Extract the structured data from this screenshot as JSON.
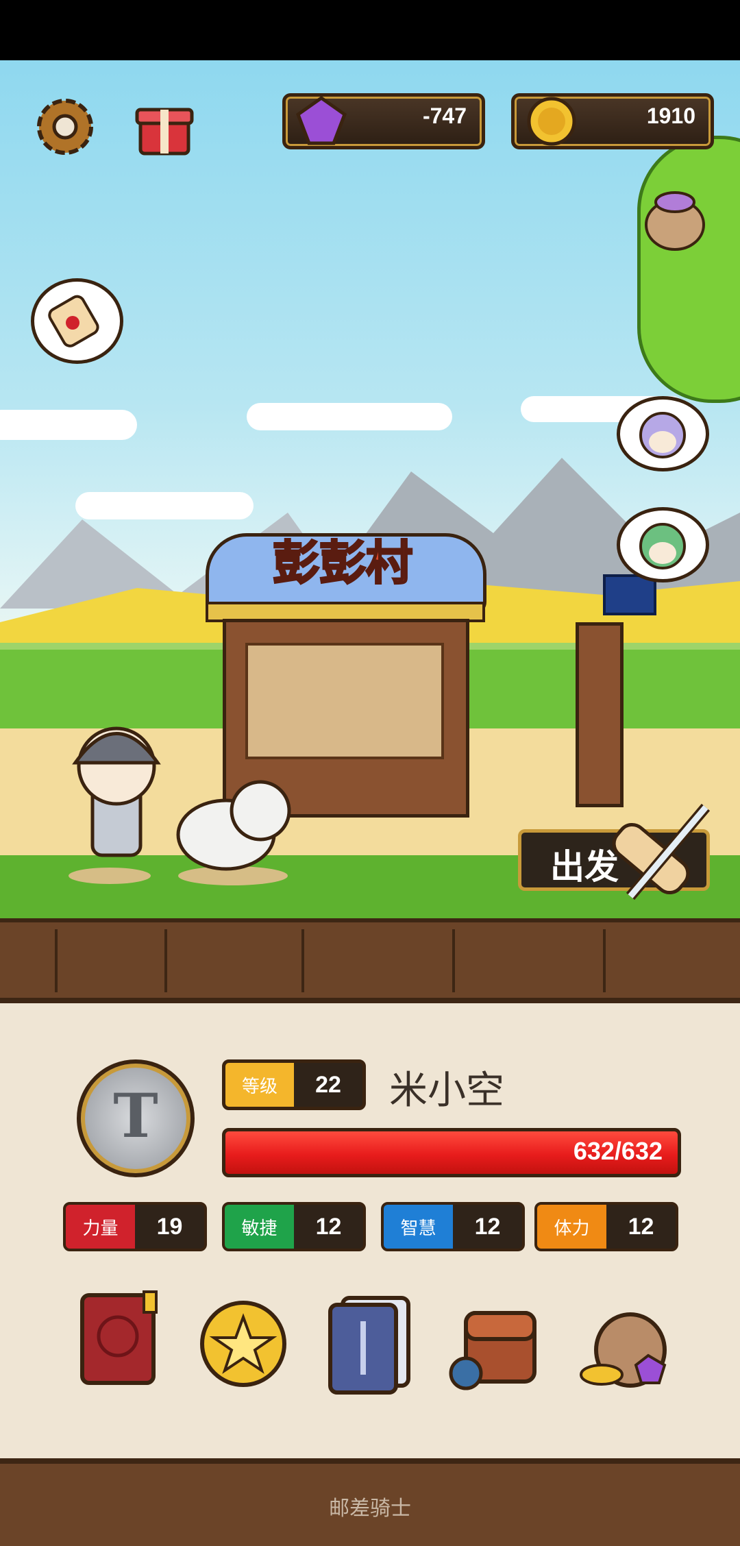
{
  "resources": {
    "gems": "-747",
    "coins": "1910"
  },
  "village": {
    "name": "彭彭村"
  },
  "depart_button": {
    "label": "出发"
  },
  "player": {
    "level_label": "等级",
    "level": "22",
    "name": "米小空",
    "hp": "632/632",
    "emblem": "T"
  },
  "stats": [
    {
      "label": "力量",
      "value": "19",
      "color": "#d0222c"
    },
    {
      "label": "敏捷",
      "value": "12",
      "color": "#1fa34a"
    },
    {
      "label": "智慧",
      "value": "12",
      "color": "#1f7fd6"
    },
    {
      "label": "体力",
      "value": "12",
      "color": "#f08a14"
    }
  ],
  "icons": [
    "settings-gear-icon",
    "gift-box-icon",
    "gem-icon",
    "coin-icon",
    "loot-bag-icon",
    "quest-scroll-icon",
    "npc-purple-hair-icon",
    "npc-green-hair-icon",
    "monster-book-icon",
    "star-coin-icon",
    "card-deck-icon",
    "backpack-icon",
    "treasure-bag-icon"
  ],
  "footer": {
    "title": "邮差骑士"
  },
  "colors": {
    "hp_bar": "#e81c1c",
    "level_badge": "#f4b62c"
  }
}
